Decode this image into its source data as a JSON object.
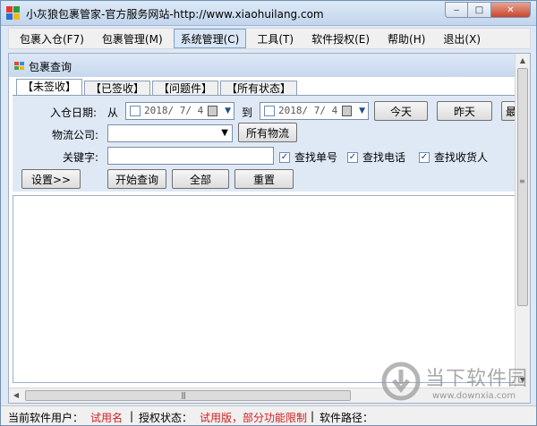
{
  "window": {
    "title": "小灰狼包裹管家-官方服务网站-http://www.xiaohuilang.com"
  },
  "menu": [
    {
      "label": "包裹入仓(F7)"
    },
    {
      "label": "包裹管理(M)"
    },
    {
      "label": "系统管理(C)"
    },
    {
      "label": "工具(T)"
    },
    {
      "label": "软件授权(E)"
    },
    {
      "label": "帮助(H)"
    },
    {
      "label": "退出(X)"
    }
  ],
  "panel": {
    "title": "包裹查询",
    "tabs": [
      {
        "label": "【未签收】"
      },
      {
        "label": "【已签收】"
      },
      {
        "label": "【问题件】"
      },
      {
        "label": "【所有状态】"
      }
    ]
  },
  "form": {
    "date_label": "入仓日期:",
    "from_label": "从",
    "to_label": "到",
    "date_from": "2018/ 7/ 4",
    "date_to": "2018/ 7/ 4",
    "today_button": "今天",
    "yesterday_button": "昨天",
    "more_button": "最",
    "carrier_label": "物流公司:",
    "carrier_value": "",
    "all_carriers_button": "所有物流",
    "keyword_label": "关键字:",
    "keyword_value": "",
    "check_tracking": "查找单号",
    "check_phone": "查找电话",
    "check_recipient": "查找收货人",
    "settings_button": "设置>>",
    "search_button": "开始查询",
    "all_button": "全部",
    "reset_button": "重置"
  },
  "status": {
    "user_label": "当前软件用户：",
    "user_value": "试用名",
    "sep1": "|",
    "license_label": "授权状态：",
    "license_value": "试用版，部分功能限制",
    "sep2": "|",
    "path_label": "软件路径："
  },
  "watermark": {
    "brand": "当下软件园",
    "url": "www.downxia.com"
  },
  "colors": {
    "accent_blue": "#c7d8ee",
    "trial_red": "#d21f1f"
  }
}
